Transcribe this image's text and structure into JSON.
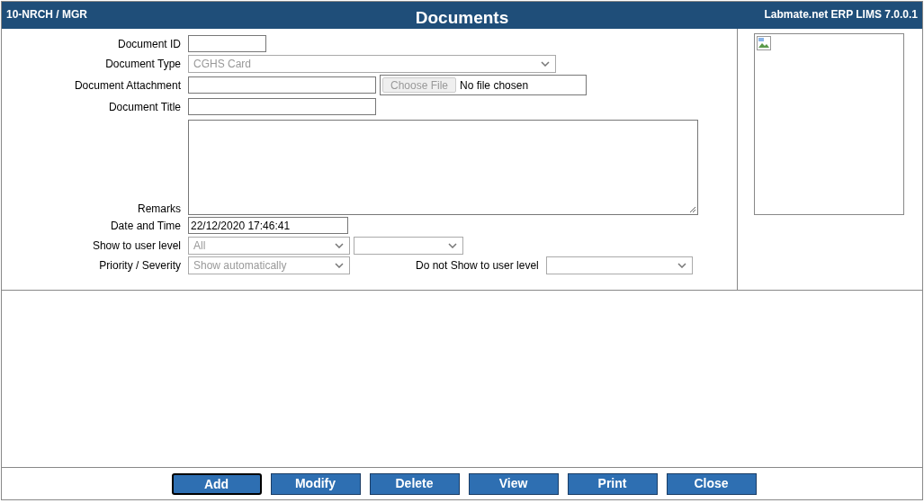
{
  "header": {
    "left": "10-NRCH / MGR",
    "title": "Documents",
    "right": "Labmate.net ERP LIMS 7.0.0.1"
  },
  "fields": [
    {
      "kind": "short_text",
      "label": "Document ID"
    },
    {
      "kind": "select",
      "label": "Document Type",
      "value": "CGHS Card",
      "disabled": true
    },
    {
      "kind": "file",
      "label": "Document Attachment",
      "button": "Choose File",
      "status": "No file chosen"
    },
    {
      "kind": "text",
      "label": "Document Title"
    },
    {
      "kind": "textarea",
      "label": "Remarks"
    },
    {
      "kind": "datetime",
      "label": "Date and Time",
      "value": "22/12/2020 17:46:41"
    },
    {
      "kind": "selectpair",
      "label": "Show to user level",
      "value": "All",
      "disabled": true
    },
    {
      "kind": "selectlabel",
      "label": "Priority / Severity",
      "value": "Show automatically",
      "disabled": true,
      "second_label": "Do not Show to user level"
    }
  ],
  "buttons": [
    {
      "label": "Add",
      "focused": true
    },
    {
      "label": "Modify",
      "focused": false
    },
    {
      "label": "Delete",
      "focused": false
    },
    {
      "label": "View",
      "focused": false
    },
    {
      "label": "Print",
      "focused": false
    },
    {
      "label": "Close",
      "focused": false
    }
  ]
}
